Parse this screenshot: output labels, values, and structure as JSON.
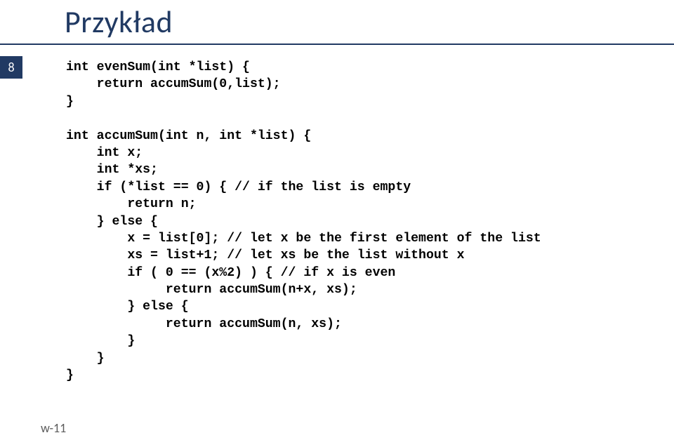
{
  "title": "Przykład",
  "page_number": "8",
  "code": "int evenSum(int *list) {\n    return accumSum(0,list);\n}\n\nint accumSum(int n, int *list) {\n    int x;\n    int *xs;\n    if (*list == 0) { // if the list is empty\n        return n;\n    } else {\n        x = list[0]; // let x be the first element of the list\n        xs = list+1; // let xs be the list without x\n        if ( 0 == (x%2) ) { // if x is even\n             return accumSum(n+x, xs);\n        } else {\n             return accumSum(n, xs);\n        }\n    }\n}",
  "footer": "w-11"
}
